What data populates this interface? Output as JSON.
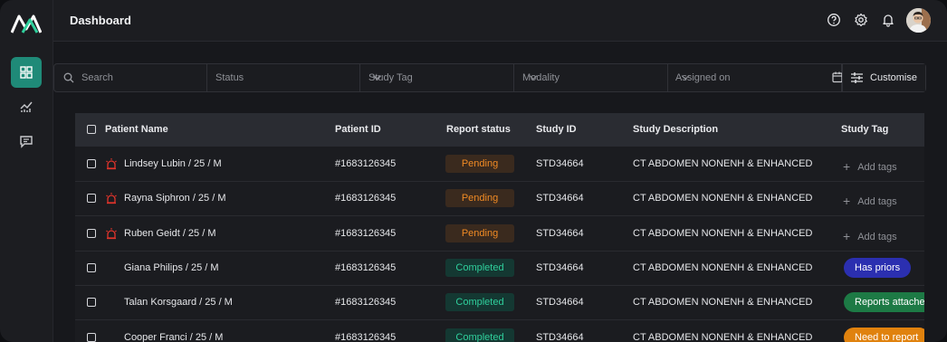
{
  "header": {
    "title": "Dashboard"
  },
  "filters": {
    "search_placeholder": "Search",
    "status": "Status",
    "study_tag": "Study Tag",
    "modality": "Modality",
    "assigned_on": "Assigned on",
    "customise": "Customise"
  },
  "table": {
    "columns": [
      "Patient Name",
      "Patient ID",
      "Report status",
      "Study ID",
      "Study Description",
      "Study Tag"
    ],
    "rows": [
      {
        "patient": "Lindsey Lubin / 25 / M",
        "risk": true,
        "id": "#1683126345",
        "status": "Pending",
        "study_id": "STD34664",
        "desc": "CT ABDOMEN NONENH & ENHANCED",
        "tag": "Add tags",
        "tag_type": "add"
      },
      {
        "patient": "Rayna Siphron / 25 / M",
        "risk": true,
        "id": "#1683126345",
        "status": "Pending",
        "study_id": "STD34664",
        "desc": "CT ABDOMEN NONENH & ENHANCED",
        "tag": "Add tags",
        "tag_type": "add"
      },
      {
        "patient": "Ruben Geidt / 25 / M",
        "risk": true,
        "id": "#1683126345",
        "status": "Pending",
        "study_id": "STD34664",
        "desc": "CT ABDOMEN NONENH & ENHANCED",
        "tag": "Add tags",
        "tag_type": "add"
      },
      {
        "patient": "Giana Philips / 25 / M",
        "risk": false,
        "id": "#1683126345",
        "status": "Completed",
        "study_id": "STD34664",
        "desc": "CT ABDOMEN NONENH & ENHANCED",
        "tag": "Has priors",
        "tag_type": "pill",
        "tag_color": "#2b2fb0"
      },
      {
        "patient": "Talan Korsgaard / 25 / M",
        "risk": false,
        "id": "#1683126345",
        "status": "Completed",
        "study_id": "STD34664",
        "desc": "CT ABDOMEN NONENH & ENHANCED",
        "tag": "Reports attached",
        "tag_type": "pill",
        "tag_color": "#1d7a45"
      },
      {
        "patient": "Cooper Franci / 25 / M",
        "risk": false,
        "id": "#1683126345",
        "status": "Completed",
        "study_id": "STD34664",
        "desc": "CT ABDOMEN NONENH & ENHANCED",
        "tag": "Need to report",
        "tag_type": "pill",
        "tag_color": "#e0820e"
      }
    ]
  },
  "colors": {
    "accent": "#1f8a78",
    "pending": "#f08a24",
    "completed": "#2fcf9c",
    "risk": "#e0342b"
  }
}
